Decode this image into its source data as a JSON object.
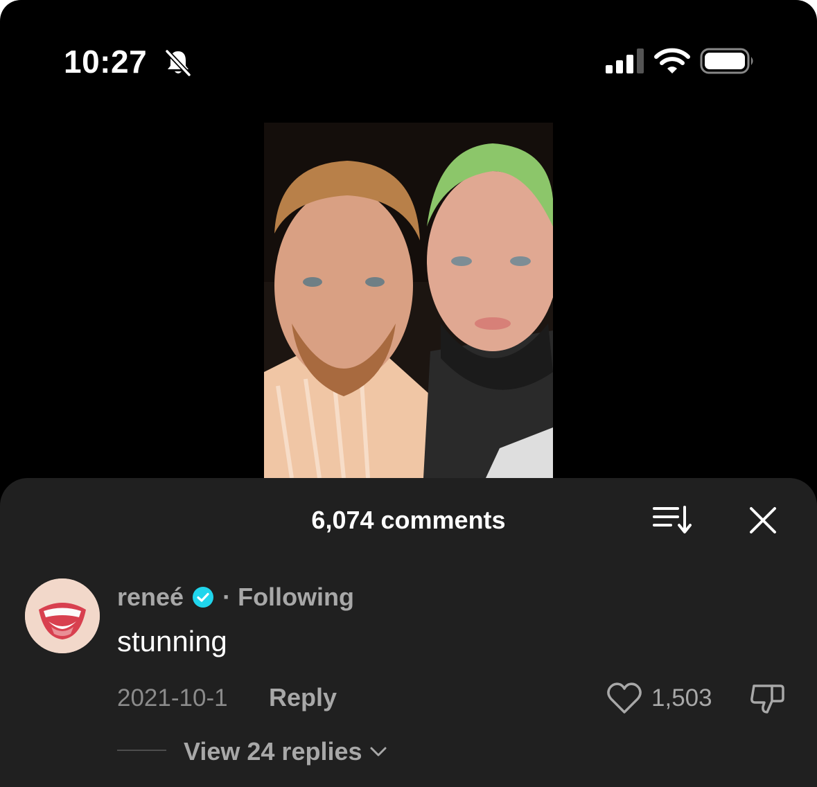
{
  "status_bar": {
    "time": "10:27",
    "icons": [
      "bell-slash-icon",
      "signal-icon",
      "wifi-icon",
      "battery-icon"
    ]
  },
  "video": {
    "content": "photo"
  },
  "comments_sheet": {
    "title": "6,074 comments",
    "icons": [
      "sort-icon",
      "close-icon"
    ],
    "comment": {
      "username": "reneé",
      "verified": true,
      "follow_status": "Following",
      "separator": "·",
      "text": "stunning",
      "date": "2021-10-1",
      "reply_label": "Reply",
      "likes": "1,503",
      "view_replies": "View 24 replies"
    }
  },
  "colors": {
    "background": "#000000",
    "sheet": "#202020",
    "muted_text": "#a8a8a8",
    "verified": "#20d5ec"
  }
}
